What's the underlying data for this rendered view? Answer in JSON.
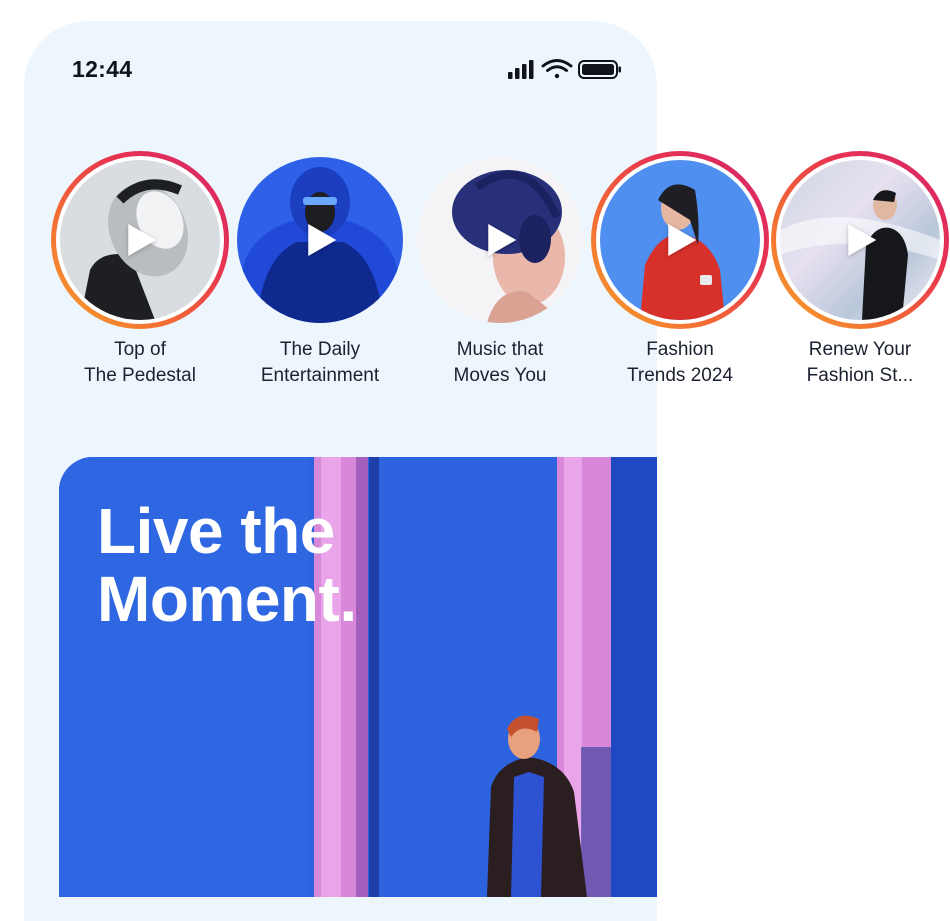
{
  "status_bar": {
    "time": "12:44",
    "icons": [
      "signal-icon",
      "wifi-icon",
      "battery-icon"
    ]
  },
  "stories": [
    {
      "line1": "Top of",
      "line2": "The Pedestal",
      "active": true,
      "colors": [
        "#d9dde1",
        "#1d1f22",
        "#b9bcc0"
      ]
    },
    {
      "line1": "The Daily",
      "line2": "Entertainment",
      "active": false,
      "colors": [
        "#2f61e8",
        "#0f2a8f",
        "#1d1d22"
      ]
    },
    {
      "line1": "Music that",
      "line2": "Moves You",
      "active": false,
      "colors": [
        "#f4f3f6",
        "#28307a",
        "#e9b8aa"
      ]
    },
    {
      "line1": "Fashion",
      "line2": "Trends 2024",
      "active": true,
      "colors": [
        "#4e8ff0",
        "#d8312c",
        "#1e1e24"
      ]
    },
    {
      "line1": "Renew Your",
      "line2": "Fashion St...",
      "active": true,
      "colors": [
        "#cfd7e3",
        "#16171b",
        "#e6e0f0"
      ]
    }
  ],
  "hero": {
    "title_line1": "Live the",
    "title_line2": "Moment.",
    "colors": {
      "background": "#2d63df",
      "pillar": "#d888d8",
      "jacket": "#2a1e20"
    }
  },
  "colors": {
    "ring_gradient": [
      "#d4246e",
      "#f8a42a"
    ],
    "screen_background": "#eef6fd"
  }
}
